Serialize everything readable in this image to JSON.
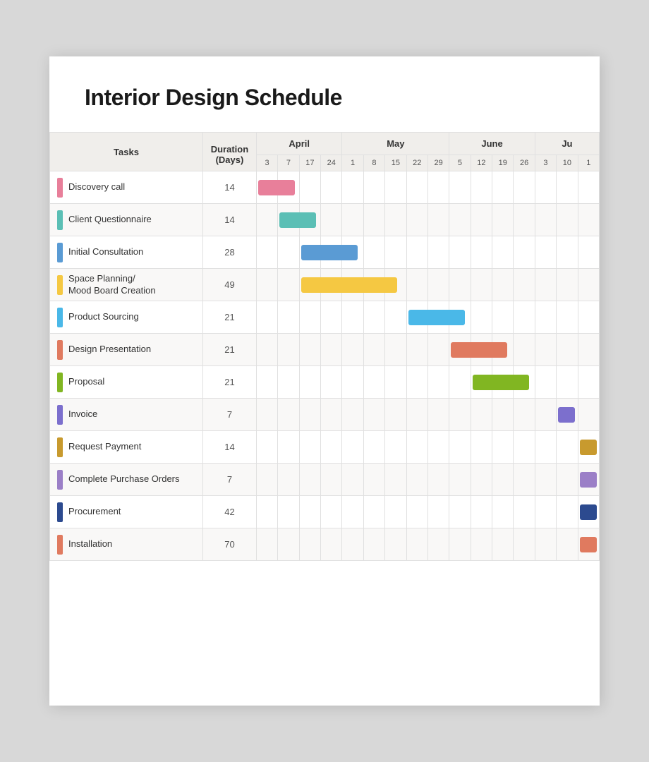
{
  "title": "Interior Design Schedule",
  "table": {
    "headers": {
      "tasks_label": "Tasks",
      "duration_label": "Duration\n(Days)"
    },
    "months": [
      {
        "label": "April",
        "span": 4
      },
      {
        "label": "May",
        "span": 4
      },
      {
        "label": "June",
        "span": 4
      },
      {
        "label": "Ju",
        "span": 3
      }
    ],
    "days": [
      3,
      7,
      17,
      24,
      1,
      8,
      15,
      22,
      29,
      5,
      12,
      19,
      26,
      3,
      10,
      1
    ],
    "rows": [
      {
        "name": "Discovery call",
        "duration": 14,
        "color": "#e87f9a",
        "bar_start": 0,
        "bar_cols": 2
      },
      {
        "name": "Client Questionnaire",
        "duration": 14,
        "color": "#5bbfb5",
        "bar_start": 1,
        "bar_cols": 2
      },
      {
        "name": "Initial Consultation",
        "duration": 28,
        "color": "#5a9bd4",
        "bar_start": 2,
        "bar_cols": 3
      },
      {
        "name": "Space Planning/\nMood Board Creation",
        "duration": 49,
        "color": "#f5c842",
        "bar_start": 2,
        "bar_cols": 5
      },
      {
        "name": "Product Sourcing",
        "duration": 21,
        "color": "#4ab8e8",
        "bar_start": 7,
        "bar_cols": 3
      },
      {
        "name": "Design Presentation",
        "duration": 21,
        "color": "#e07a5f",
        "bar_start": 9,
        "bar_cols": 3
      },
      {
        "name": "Proposal",
        "duration": 21,
        "color": "#81b622",
        "bar_start": 10,
        "bar_cols": 3
      },
      {
        "name": "Invoice",
        "duration": 7,
        "color": "#7c6fcd",
        "bar_start": 14,
        "bar_cols": 1
      },
      {
        "name": "Request Payment",
        "duration": 14,
        "color": "#c89a2e",
        "bar_start": 15,
        "bar_cols": 1
      },
      {
        "name": "Complete Purchase Orders",
        "duration": 7,
        "color": "#9b7fc7",
        "bar_start": 15,
        "bar_cols": 1
      },
      {
        "name": "Procurement",
        "duration": 42,
        "color": "#2c4a8f",
        "bar_start": 15,
        "bar_cols": 1
      },
      {
        "name": "Installation",
        "duration": 70,
        "color": "#e07a5f",
        "bar_start": 15,
        "bar_cols": 1
      }
    ]
  }
}
